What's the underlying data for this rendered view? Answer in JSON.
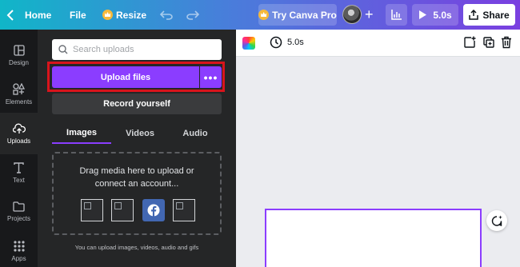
{
  "topbar": {
    "home_label": "Home",
    "file_label": "File",
    "resize_label": "Resize",
    "try_pro_label": "Try Canva Pro",
    "play_label": "5.0s",
    "share_label": "Share",
    "gradient_start": "#10b6c8",
    "gradient_end": "#7a3fe0"
  },
  "rail": {
    "items": [
      {
        "label": "Design",
        "icon": "design-icon"
      },
      {
        "label": "Elements",
        "icon": "elements-icon"
      },
      {
        "label": "Uploads",
        "icon": "upload-cloud-icon"
      },
      {
        "label": "Text",
        "icon": "text-icon"
      },
      {
        "label": "Projects",
        "icon": "folder-icon"
      },
      {
        "label": "Apps",
        "icon": "apps-grid-icon"
      }
    ],
    "active": "Uploads"
  },
  "panel": {
    "search_placeholder": "Search uploads",
    "upload_label": "Upload files",
    "upload_more": "•••",
    "record_label": "Record yourself",
    "tabs": [
      "Images",
      "Videos",
      "Audio"
    ],
    "active_tab": "Images",
    "dropzone_line1": "Drag media here to upload or",
    "dropzone_line2": "connect an account...",
    "footnote": "You can upload images, videos, audio and gifs",
    "accent": "#8b3dff",
    "highlight": "#d8141c"
  },
  "canvas": {
    "duration": "5.0s"
  }
}
